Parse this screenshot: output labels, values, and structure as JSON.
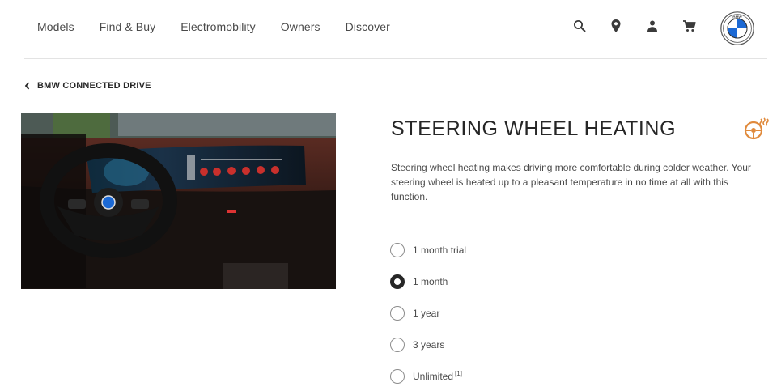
{
  "nav": {
    "links": [
      "Models",
      "Find & Buy",
      "Electromobility",
      "Owners",
      "Discover"
    ],
    "icons": [
      "search-icon",
      "location-pin-icon",
      "user-icon",
      "cart-icon"
    ],
    "logo_text": "BMW"
  },
  "breadcrumb": {
    "label": "BMW CONNECTED DRIVE"
  },
  "product": {
    "image_alt": "BMW interior with steering wheel and curved display",
    "title": "STEERING WHEEL HEATING",
    "description": "Steering wheel heating makes driving more comfortable during colder weather. Your steering wheel is heated up to a pleasant temperature in no time at all with this function.",
    "feature_icon": "heated-steering-wheel-icon",
    "accent_color": "#e08a3c"
  },
  "options": [
    {
      "label": "1 month trial",
      "selected": false,
      "footnote": ""
    },
    {
      "label": "1 month",
      "selected": true,
      "footnote": ""
    },
    {
      "label": "1 year",
      "selected": false,
      "footnote": ""
    },
    {
      "label": "3 years",
      "selected": false,
      "footnote": ""
    },
    {
      "label": "Unlimited",
      "selected": false,
      "footnote": "[1]"
    }
  ]
}
